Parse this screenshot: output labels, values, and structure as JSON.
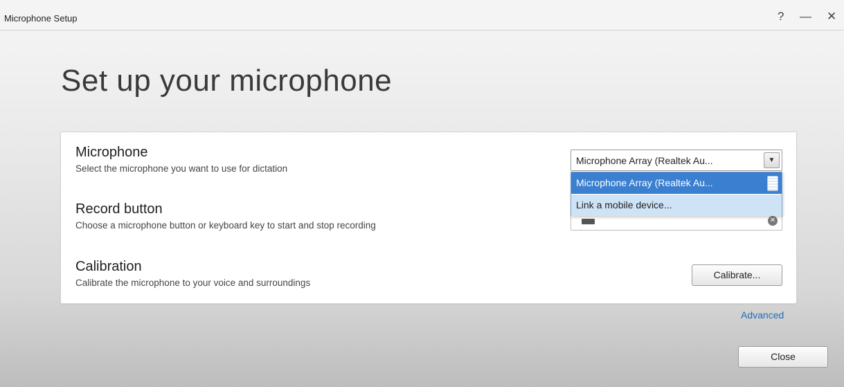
{
  "window": {
    "title": "Microphone Setup",
    "help": "?",
    "minimize": "—",
    "close": "✕"
  },
  "heading": "Set up your microphone",
  "microphone": {
    "title": "Microphone",
    "description": "Select the microphone you want to use for dictation",
    "selected_value": "Microphone Array (Realtek Au...",
    "dropdown_arrow": "▼",
    "options": [
      "Microphone Array (Realtek Au...",
      "Link a mobile device..."
    ]
  },
  "record": {
    "title": "Record button",
    "description": "Choose a microphone button or keyboard key to start and stop recording",
    "clear_glyph": "✕"
  },
  "calibration": {
    "title": "Calibration",
    "description": "Calibrate the microphone to your voice and surroundings",
    "button_label": "Calibrate..."
  },
  "advanced_link": "Advanced",
  "close_button": "Close",
  "colors": {
    "link": "#1d6bb6",
    "selection": "#3a7fd0",
    "hover": "#cfe3f7"
  }
}
